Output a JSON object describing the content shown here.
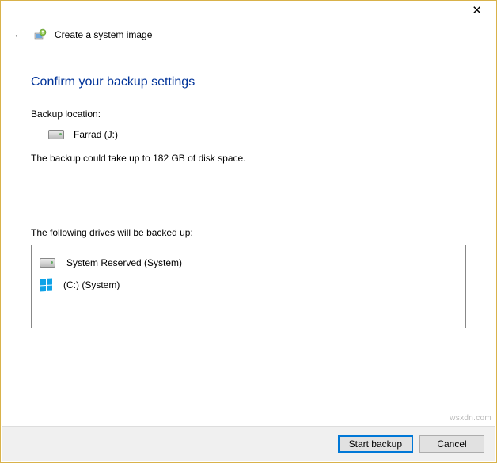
{
  "window": {
    "title": "Create a system image"
  },
  "page": {
    "heading": "Confirm your backup settings",
    "backup_location_label": "Backup location:",
    "backup_location_value": "Farrad (J:)",
    "size_note": "The backup could take up to 182 GB of disk space.",
    "drives_label": "The following drives will be backed up:",
    "drives": [
      {
        "icon": "hdd",
        "label": "System Reserved (System)"
      },
      {
        "icon": "windows",
        "label": "(C:) (System)"
      }
    ]
  },
  "buttons": {
    "start": "Start backup",
    "cancel": "Cancel"
  },
  "watermark": "wsxdn.com"
}
